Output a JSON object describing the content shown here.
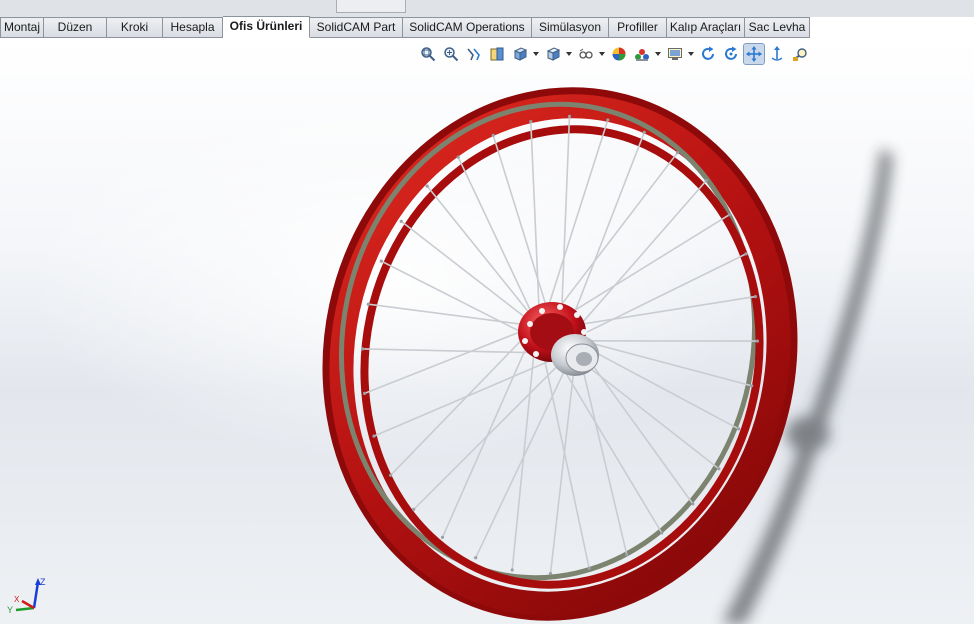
{
  "window": {
    "tabs": [
      {
        "label": "Montaj",
        "active": false
      },
      {
        "label": "Düzen",
        "active": false
      },
      {
        "label": "Kroki",
        "active": false
      },
      {
        "label": "Hesapla",
        "active": false
      },
      {
        "label": "Ofis Ürünleri",
        "active": true
      },
      {
        "label": "SolidCAM Part",
        "active": false
      },
      {
        "label": "SolidCAM Operations",
        "active": false
      },
      {
        "label": "Simülasyon",
        "active": false
      },
      {
        "label": "Profiller",
        "active": false
      },
      {
        "label": "Kalıp Araçları",
        "active": false
      },
      {
        "label": "Sac Levha",
        "active": false
      }
    ]
  },
  "view_toolbar": {
    "buttons": [
      {
        "icon": "zoom-to-fit-icon"
      },
      {
        "icon": "zoom-to-area-icon"
      },
      {
        "icon": "previous-view-icon"
      },
      {
        "icon": "section-view-icon"
      },
      {
        "icon": "view-orientation-icon",
        "dropdown": true
      },
      {
        "icon": "display-style-icon",
        "dropdown": true
      },
      {
        "icon": "hide-show-items-icon",
        "dropdown": true
      },
      {
        "icon": "edit-appearance-icon"
      },
      {
        "icon": "apply-scene-icon",
        "dropdown": true
      },
      {
        "icon": "view-settings-icon",
        "dropdown": true
      },
      {
        "icon": "rotate-view-icon"
      },
      {
        "icon": "rotate-about-icon"
      },
      {
        "icon": "pan-icon",
        "pressed": true
      },
      {
        "icon": "up-direction-icon"
      },
      {
        "icon": "zoom-in-out-icon"
      }
    ]
  },
  "model": {
    "rim_color": "#b01313",
    "rim_inner_color": "#7c8470",
    "spoke_color": "#c9ccd1",
    "hub_color": "#c0101a",
    "axle_color": "#d7dadf",
    "spoke_count": 32
  },
  "triad": {
    "x_label": "X",
    "y_label": "Y",
    "z_label": "Z",
    "x_color": "#d11a1a",
    "y_color": "#1f9a2a",
    "z_color": "#1b3fd6"
  }
}
